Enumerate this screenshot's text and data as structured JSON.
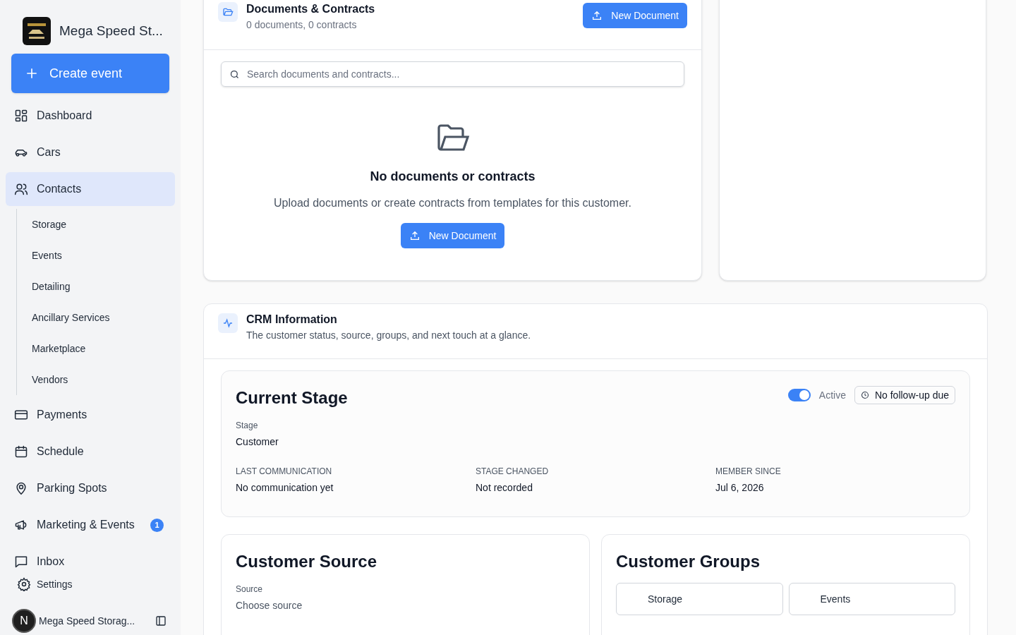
{
  "sidebar": {
    "brand": "Mega Speed St...",
    "create_button": "Create event",
    "items": [
      {
        "kind": "dashboard",
        "label": "Dashboard",
        "selected": false
      },
      {
        "kind": "car",
        "label": "Cars",
        "selected": false
      },
      {
        "kind": "contacts",
        "label": "Contacts",
        "selected": true,
        "children": [
          {
            "label": "Storage"
          },
          {
            "label": "Events"
          },
          {
            "label": "Detailing"
          },
          {
            "label": "Ancillary Services"
          },
          {
            "label": "Marketplace"
          },
          {
            "label": "Vendors"
          }
        ]
      },
      {
        "kind": "card",
        "label": "Payments",
        "selected": false
      },
      {
        "kind": "calendar",
        "label": "Schedule",
        "selected": false
      },
      {
        "kind": "pin",
        "label": "Parking Spots",
        "selected": false
      },
      {
        "kind": "megaphone",
        "label": "Marketing & Events",
        "selected": false,
        "badge": "1"
      },
      {
        "kind": "chat",
        "label": "Inbox",
        "selected": false
      }
    ],
    "settings": "Settings",
    "avatar_initial": "N",
    "account": "Mega Speed Storag..."
  },
  "documents": {
    "title": "Documents & Contracts",
    "subtitle": "0 documents, 0 contracts",
    "new_button": "New Document",
    "search_placeholder": "Search documents and contracts...",
    "empty_title": "No documents or contracts",
    "empty_text": "Upload documents or create contracts from templates for this customer.",
    "empty_button": "New Document"
  },
  "crm": {
    "title": "CRM Information",
    "subtitle": "The customer status, source, groups, and next touch at a glance.",
    "stage": {
      "title": "Current Stage",
      "active_label": "Active",
      "active": true,
      "follow_up": "No follow-up due",
      "stage_label": "Stage",
      "stage_value": "Customer",
      "facts": [
        {
          "label": "LAST COMMUNICATION",
          "value": "No communication yet"
        },
        {
          "label": "STAGE CHANGED",
          "value": "Not recorded"
        },
        {
          "label": "MEMBER SINCE",
          "value": "Jul 6, 2026"
        }
      ]
    },
    "source": {
      "title": "Customer Source",
      "label": "Source",
      "placeholder": "Choose source"
    },
    "groups": {
      "title": "Customer Groups",
      "items": [
        {
          "label": "Storage"
        },
        {
          "label": "Events"
        }
      ]
    }
  }
}
